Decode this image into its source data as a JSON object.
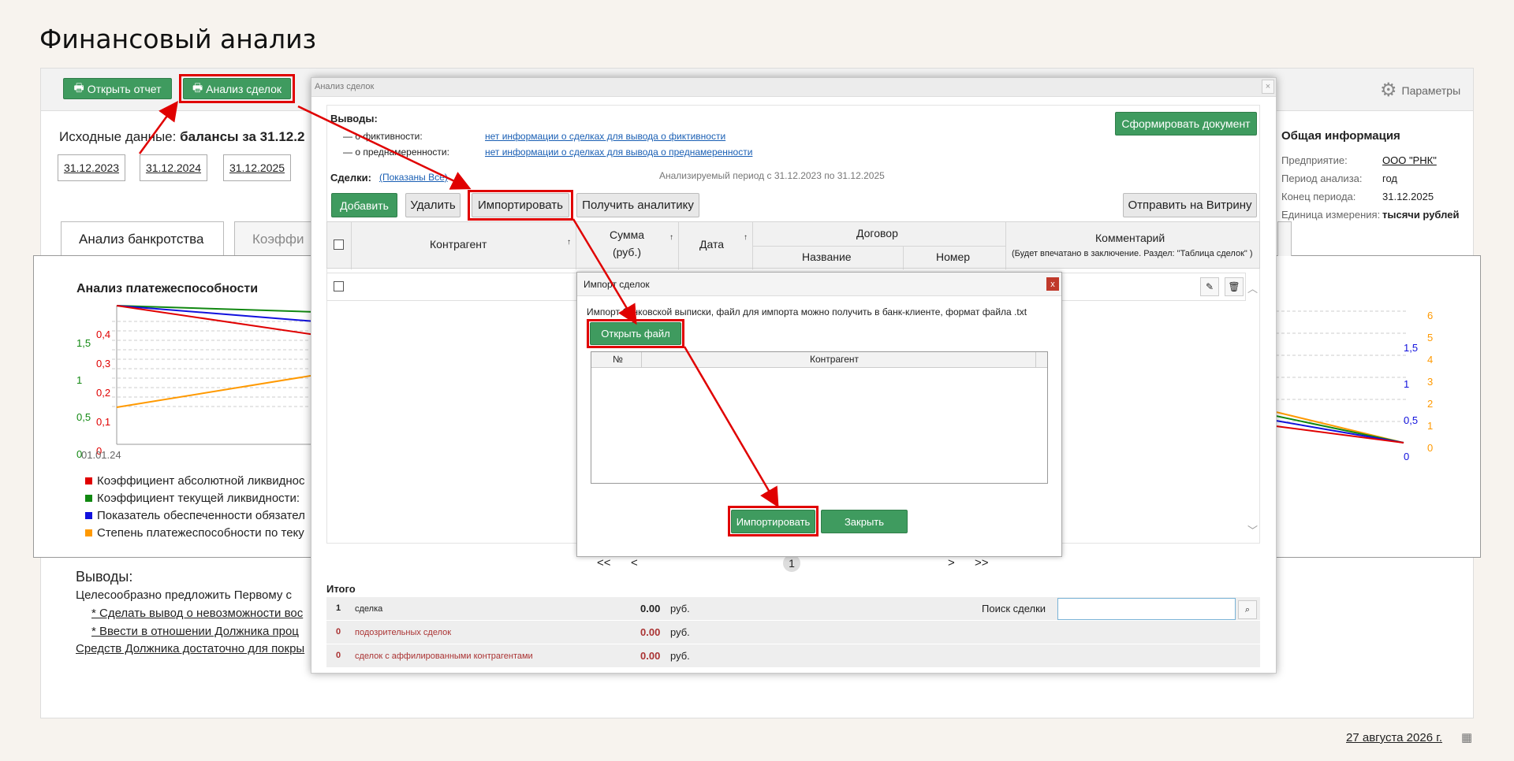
{
  "page": {
    "title": "Финансовый анализ"
  },
  "toolbar": {
    "open_report": "Открыть отчет",
    "deal_analysis": "Анализ сделок",
    "params": "Параметры"
  },
  "source": {
    "label": "Исходные данные:",
    "value": "балансы за 31.12.2",
    "dates": [
      "31.12.2023",
      "31.12.2024",
      "31.12.2025"
    ]
  },
  "tabs": [
    "Анализ банкротства",
    "Коэффи"
  ],
  "general_info": {
    "title": "Общая информация",
    "rows": [
      {
        "label": "Предприятие:",
        "value": "ООО \"РНК\""
      },
      {
        "label": "Период анализа:",
        "value": "год"
      },
      {
        "label": "Конец периода:",
        "value": "31.12.2025"
      },
      {
        "label": "Единица измерения:",
        "value": "тысячи рублей"
      }
    ]
  },
  "chart": {
    "title": "Анализ платежеспособности",
    "x_label": "01.01.24",
    "left_ticks_green": [
      "1,5",
      "1",
      "0,5",
      "0"
    ],
    "left_ticks_red": [
      "0,4",
      "0,3",
      "0,2",
      "0,1",
      "0"
    ],
    "right_ticks_blue": [
      "1,5",
      "1",
      "0,5",
      "0"
    ],
    "right_ticks_orange": [
      "6",
      "5",
      "4",
      "3",
      "2",
      "1",
      "0"
    ],
    "legend": [
      {
        "text": "Коэффициент абсолютной ликвиднос",
        "color": "#e00000"
      },
      {
        "text": "Коэффициент текущей ликвидности:",
        "color": "#118811"
      },
      {
        "text": "Показатель обеспеченности обязател",
        "color": "#1111dd"
      },
      {
        "text": "Степень платежеспособности по теку",
        "color": "#ff9900"
      }
    ]
  },
  "conclusions": {
    "title": "Выводы:",
    "line1": "Целесообразно предложить Первому с",
    "line2": "* Сделать вывод о невозможности вос",
    "line3": "* Ввести в отношении Должника проц",
    "line4": "Средств Должника достаточно для покры"
  },
  "footer": {
    "date": "27 августа 2026 г."
  },
  "dialog": {
    "title": "Анализ сделок",
    "conclusions_label": "Выводы",
    "fict_label": "— о фиктивности:",
    "fict_link": "нет информации о сделках для вывода о фиктивности",
    "premed_label": "— о преднамеренности:",
    "premed_link": "нет информации о сделках для вывода о преднамеренности",
    "form_doc": "Сформировать документ",
    "deals_label": "Сделки:",
    "deals_filter": "(Показаны Все)",
    "period": "Анализируемый период с 31.12.2023 по 31.12.2025",
    "buttons": {
      "add": "Добавить",
      "delete": "Удалить",
      "import": "Импортировать",
      "analytics": "Получить аналитику",
      "send": "Отправить на Витрину"
    },
    "columns": {
      "counterparty": "Контрагент",
      "sum": "Сумма",
      "sum_unit": "(руб.)",
      "date": "Дата",
      "contract": "Договор",
      "contract_name": "Название",
      "contract_number": "Номер",
      "comment": "Комментарий",
      "comment_note": "(Будет впечатано в заключение. Раздел: \"Таблица сделок\" )"
    },
    "pager": {
      "first": "<<",
      "prev": "<",
      "page": "1",
      "next": ">",
      "last": ">>"
    },
    "totals_label": "Итого",
    "totals": [
      {
        "n": "1",
        "label": "сделка",
        "amount": "0.00",
        "unit": "руб."
      },
      {
        "n": "0",
        "label": "подозрительных сделок",
        "amount": "0.00",
        "unit": "руб."
      },
      {
        "n": "0",
        "label": "сделок с аффилированными контрагентами",
        "amount": "0.00",
        "unit": "руб."
      }
    ],
    "search_label": "Поиск сделки",
    "search_value": ""
  },
  "import_dialog": {
    "title": "Импорт сделок",
    "close": "x",
    "hint": "Импорт банковской выписки, файл для импорта можно получить в банк-клиенте, формат файла .txt",
    "open_file": "Открыть файл",
    "col_num": "№",
    "col_counterparty": "Контрагент",
    "import": "Импортировать",
    "close_btn": "Закрыть"
  }
}
